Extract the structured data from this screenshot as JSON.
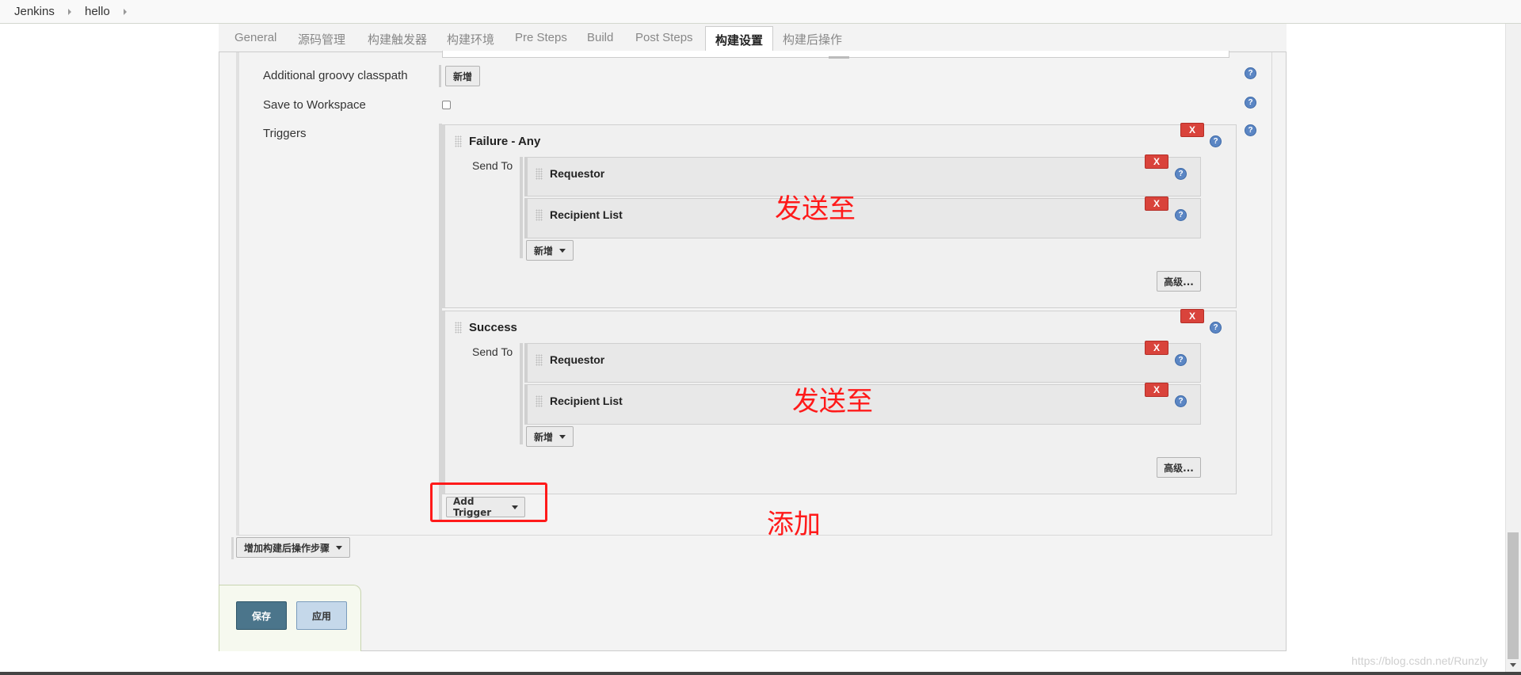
{
  "breadcrumb": [
    "Jenkins",
    "hello"
  ],
  "tabs": [
    "General",
    "源码管理",
    "构建触发器",
    "构建环境",
    "Pre Steps",
    "Build",
    "Post Steps",
    "构建设置",
    "构建后操作"
  ],
  "active_tab": "构建设置",
  "rows": {
    "groovy_label": "Additional groovy classpath",
    "groovy_add": "新增",
    "workspace_label": "Save to Workspace",
    "triggers_label": "Triggers"
  },
  "triggers": [
    {
      "title": "Failure - Any",
      "send_to": "Send To",
      "recipients": [
        "Requestor",
        "Recipient List"
      ],
      "add_label": "新增",
      "advanced_label": "高级...",
      "remove": "X"
    },
    {
      "title": "Success",
      "send_to": "Send To",
      "recipients": [
        "Requestor",
        "Recipient List"
      ],
      "add_label": "新增",
      "advanced_label": "高级...",
      "remove": "X"
    }
  ],
  "add_trigger_label": "Add Trigger",
  "add_post_build_label": "增加构建后操作步骤",
  "save_label": "保存",
  "apply_label": "应用",
  "help_glyph": "?",
  "annotations": {
    "send_to_1": "发送至",
    "send_to_2": "发送至",
    "add": "添加"
  },
  "watermark": "https://blog.csdn.net/Runzly",
  "colors": {
    "remove_button": "#d9433b",
    "save_button": "#4b758b",
    "apply_button": "#c5d8ea",
    "annotation": "#ff1a1a"
  }
}
